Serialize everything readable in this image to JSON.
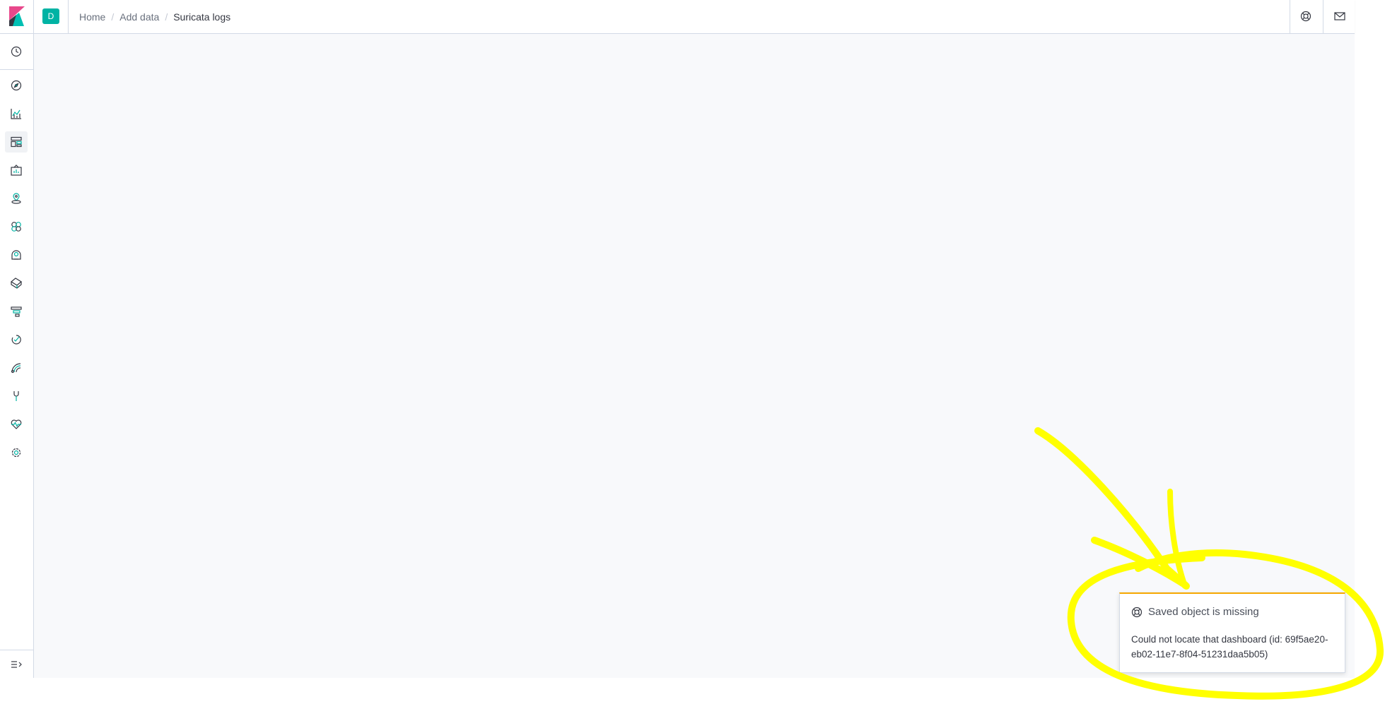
{
  "header": {
    "space_initial": "D",
    "breadcrumbs": [
      "Home",
      "Add data",
      "Suricata logs"
    ]
  },
  "sidebar": {
    "items": [
      {
        "icon": "clock-icon",
        "label": "Recently viewed"
      },
      {
        "icon": "compass-icon",
        "label": "Discover"
      },
      {
        "icon": "visualize-icon",
        "label": "Visualize"
      },
      {
        "icon": "dashboard-icon",
        "label": "Dashboard",
        "active": true
      },
      {
        "icon": "canvas-icon",
        "label": "Canvas"
      },
      {
        "icon": "maps-icon",
        "label": "Maps"
      },
      {
        "icon": "machine-learning-icon",
        "label": "Machine Learning"
      },
      {
        "icon": "infrastructure-icon",
        "label": "Infrastructure"
      },
      {
        "icon": "logs-icon",
        "label": "Logs"
      },
      {
        "icon": "apm-icon",
        "label": "APM"
      },
      {
        "icon": "uptime-icon",
        "label": "Uptime"
      },
      {
        "icon": "siem-icon",
        "label": "SIEM"
      },
      {
        "icon": "dev-tools-icon",
        "label": "Dev Tools"
      },
      {
        "icon": "monitoring-icon",
        "label": "Stack Monitoring"
      },
      {
        "icon": "management-icon",
        "label": "Management"
      }
    ]
  },
  "toast": {
    "title": "Saved object is missing",
    "body": "Could not locate that dashboard (id: 69f5ae20-eb02-11e7-8f04-51231daa5b05)"
  },
  "colors": {
    "accent": "#00b3a4",
    "warning": "#f5a700",
    "annotation": "#ffff00",
    "background": "#f8f9fb"
  }
}
